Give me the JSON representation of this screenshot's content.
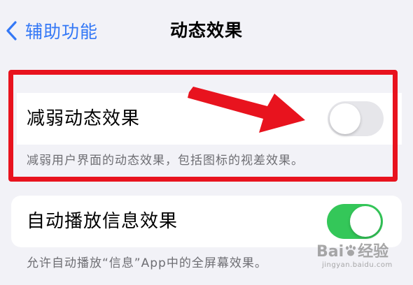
{
  "nav": {
    "back_label": "辅助功能",
    "title": "动态效果"
  },
  "settings": [
    {
      "label": "减弱动态效果",
      "enabled": false,
      "footer": "减弱用户界面的动态效果，包括图标的视差效果。"
    },
    {
      "label": "自动播放信息效果",
      "enabled": true,
      "footer": "允许自动播放“信息”App中的全屏幕效果。"
    }
  ],
  "annotation": {
    "highlight_color": "#e8131e",
    "arrow_color": "#e8131e"
  },
  "watermark": {
    "brand": "Bai",
    "brand_suffix": "经验",
    "url": "jingyan.baidu.com"
  },
  "colors": {
    "accent": "#3478f6",
    "toggle_on": "#34c759",
    "toggle_off": "#e6e6ea",
    "background": "#f2f2f7"
  },
  "icons": {
    "back": "chevron-left-icon",
    "arrow": "arrow-right-icon",
    "paw": "paw-icon"
  }
}
